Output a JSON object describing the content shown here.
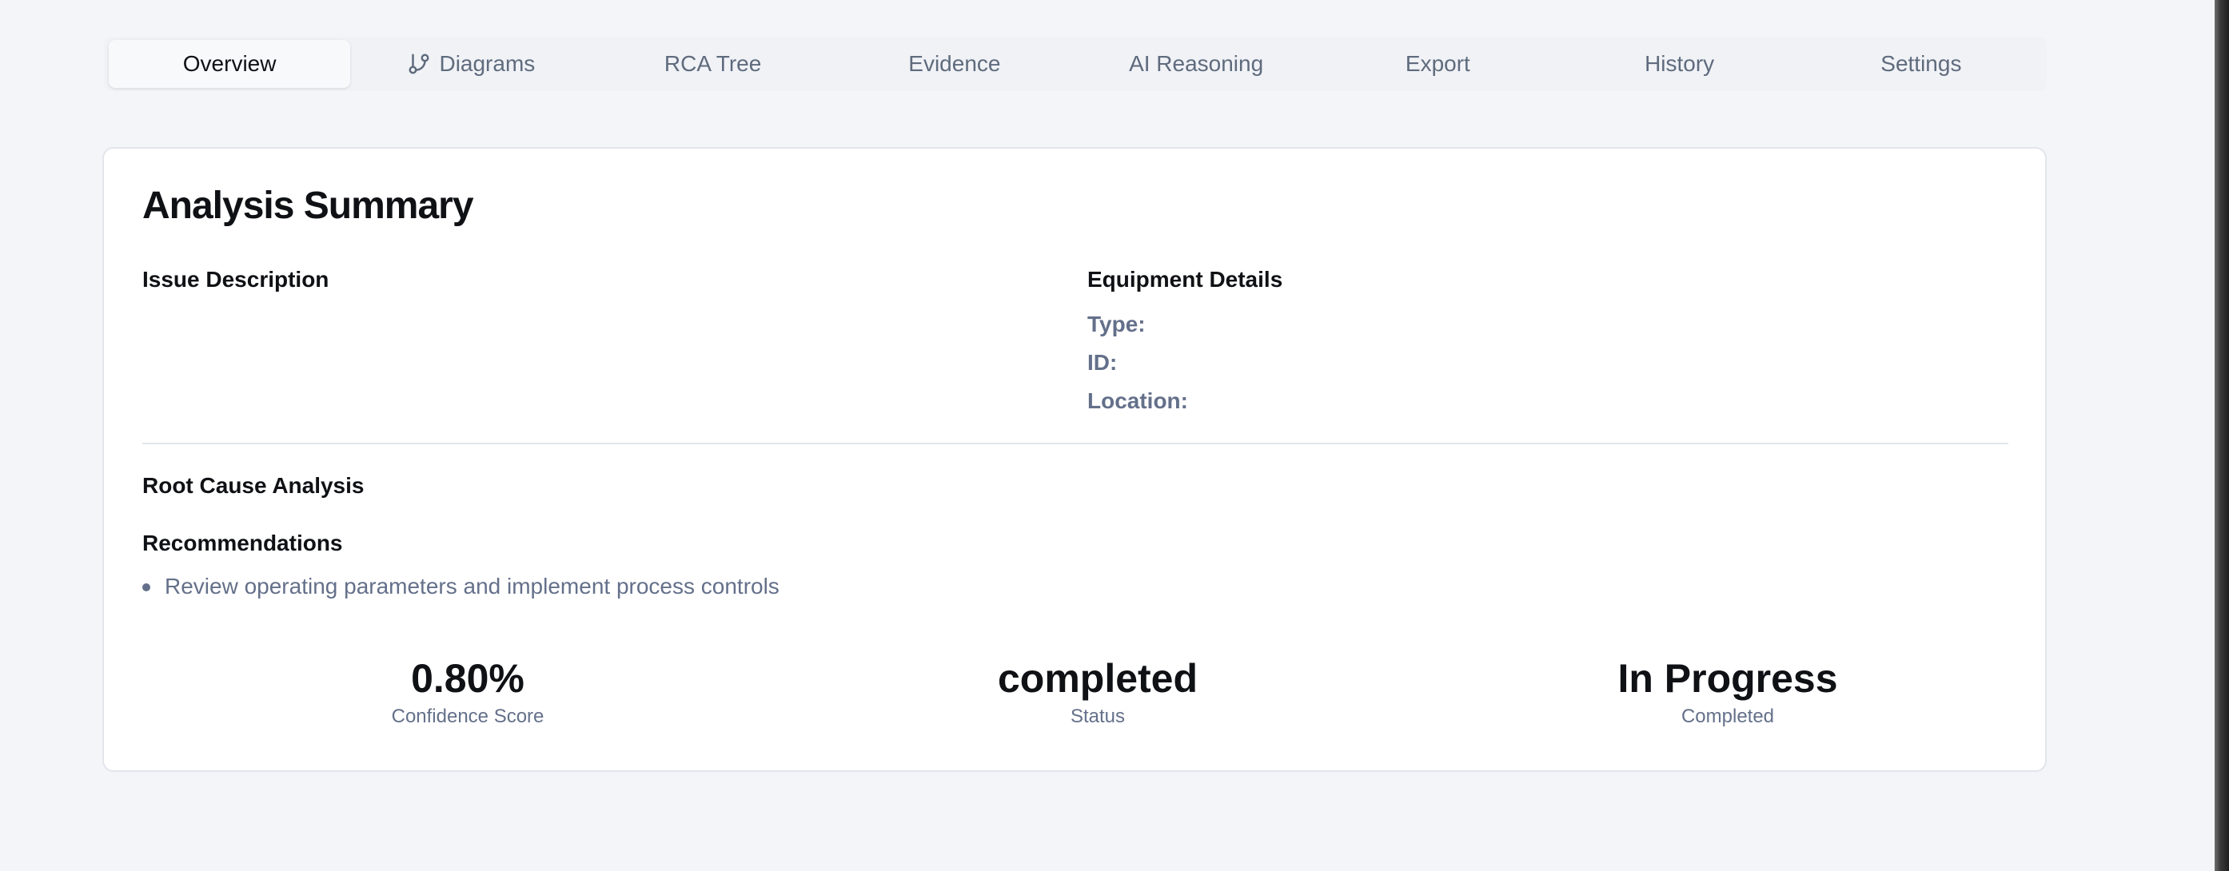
{
  "tabs": [
    {
      "label": "Overview",
      "active": true,
      "icon": null
    },
    {
      "label": "Diagrams",
      "active": false,
      "icon": "git-branch-icon"
    },
    {
      "label": "RCA Tree",
      "active": false,
      "icon": null
    },
    {
      "label": "Evidence",
      "active": false,
      "icon": null
    },
    {
      "label": "AI Reasoning",
      "active": false,
      "icon": null
    },
    {
      "label": "Export",
      "active": false,
      "icon": null
    },
    {
      "label": "History",
      "active": false,
      "icon": null
    },
    {
      "label": "Settings",
      "active": false,
      "icon": null
    }
  ],
  "summary": {
    "title": "Analysis Summary",
    "issue_description": {
      "heading": "Issue Description",
      "text": ""
    },
    "equipment_details": {
      "heading": "Equipment Details",
      "type_label": "Type:",
      "type_value": "",
      "id_label": "ID:",
      "id_value": "",
      "location_label": "Location:",
      "location_value": ""
    },
    "root_cause": {
      "heading": "Root Cause Analysis"
    },
    "recommendations": {
      "heading": "Recommendations",
      "items": [
        "Review operating parameters and implement process controls"
      ]
    },
    "stats": [
      {
        "value": "0.80%",
        "label": "Confidence Score"
      },
      {
        "value": "completed",
        "label": "Status"
      },
      {
        "value": "In Progress",
        "label": "Completed"
      }
    ]
  },
  "colors": {
    "background": "#f4f5f9",
    "card": "#ffffff",
    "muted_text": "#64708a",
    "primary_text": "#0f1115"
  }
}
